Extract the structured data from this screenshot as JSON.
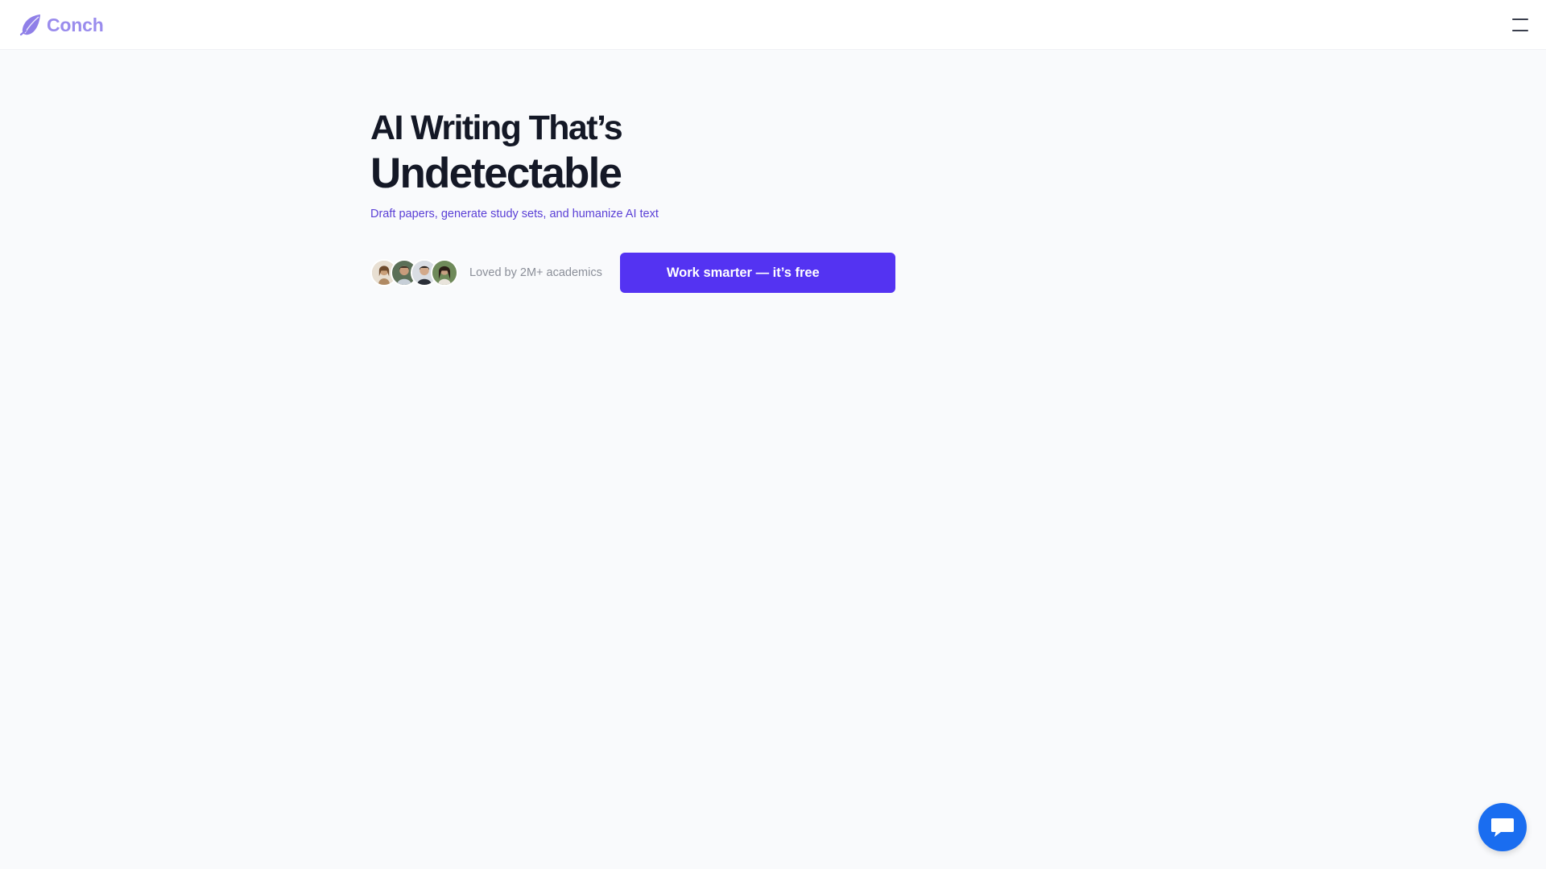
{
  "brand": {
    "name": "Conch",
    "accent": "#9a8ced",
    "icon": "leaf-shell-icon"
  },
  "header": {
    "menu_icon": "hamburger-menu-icon"
  },
  "hero": {
    "title_line1": "AI Writing That’s",
    "title_line2": "Undetectable",
    "subtitle": "Draft papers, generate study sets, and humanize AI text"
  },
  "social_proof": {
    "avatars": [
      "avatar-1",
      "avatar-2",
      "avatar-3",
      "avatar-4"
    ],
    "text": "Loved by 2M+ academics"
  },
  "cta": {
    "label": "Work smarter — it’s free",
    "color": "#5433f2"
  },
  "chat_widget": {
    "icon": "chat-bubble-icon",
    "color": "#1a6df0"
  }
}
